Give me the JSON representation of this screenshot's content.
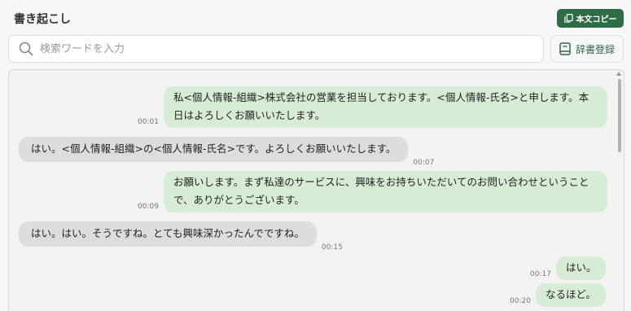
{
  "header": {
    "title": "書き起こし",
    "copy_label": "本文コピー"
  },
  "search": {
    "placeholder": "検索ワードを入力"
  },
  "dictionary": {
    "label": "辞書登録"
  },
  "colors": {
    "accent": "#2e6b47",
    "speaker_a_bubble": "#d6ecd4",
    "speaker_b_bubble": "#dddddd"
  },
  "messages": [
    {
      "side": "right",
      "time": "00:01",
      "text": "私<個人情報-組織>株式会社の営業を担当しております。<個人情報-氏名>と申します。本日はよろしくお願いいたします。"
    },
    {
      "side": "left",
      "time": "00:07",
      "text": "はい。<個人情報-組織>の<個人情報-氏名>です。よろしくお願いいたします。"
    },
    {
      "side": "right",
      "time": "00:09",
      "text": "お願いします。まず私達のサービスに、興味をお持ちいただいてのお問い合わせということで、ありがとうございます。"
    },
    {
      "side": "left",
      "time": "00:15",
      "text": "はい。はい。そうですね。とても興味深かったんでですね。"
    },
    {
      "side": "right",
      "time": "00:17",
      "text": "はい。"
    },
    {
      "side": "right",
      "time": "00:20",
      "text": "なるほど。"
    }
  ]
}
